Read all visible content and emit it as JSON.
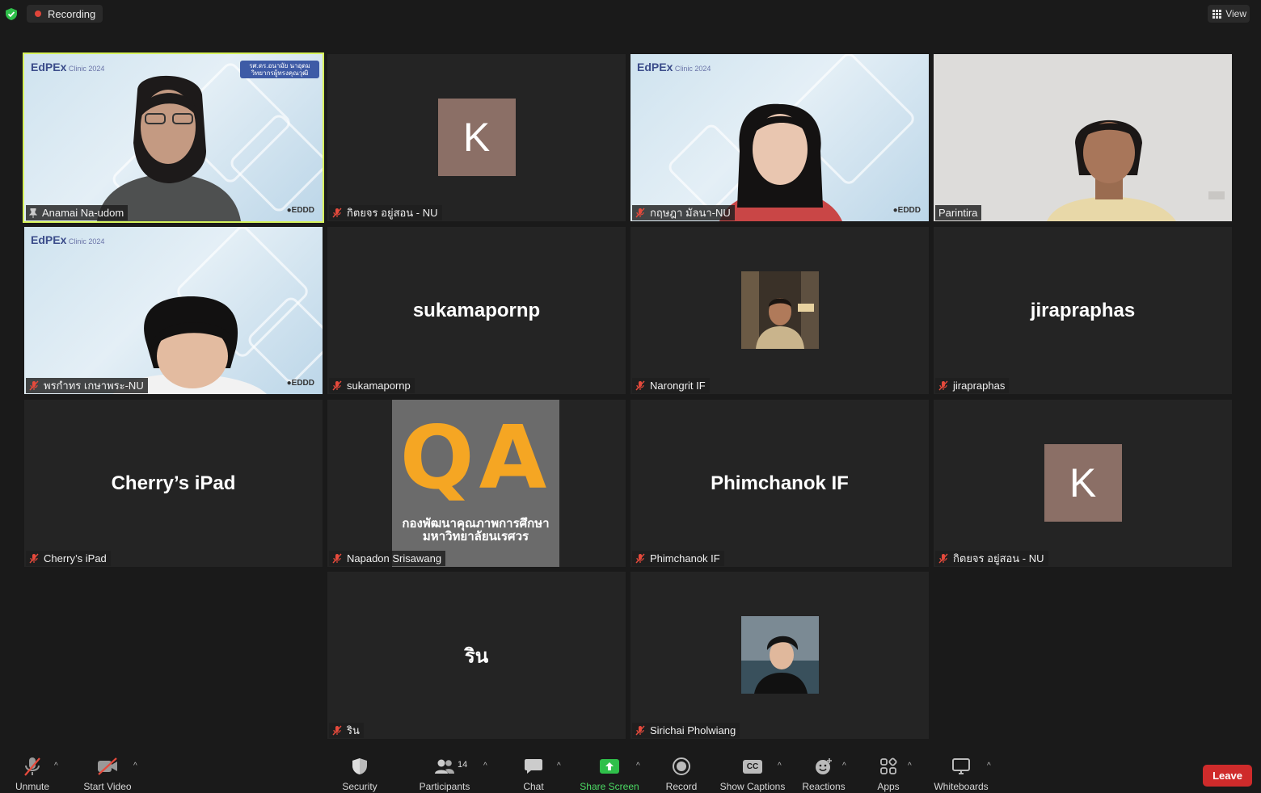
{
  "topbar": {
    "recording_label": "Recording",
    "view_label": "View"
  },
  "participants": [
    {
      "name": "Anamai Na-udom",
      "video": true,
      "pinned": true,
      "speaking": true,
      "background": "EdPEx Clinic 2024 Online",
      "ribbon_line1": "รศ.ดร.อนามัย นาอุดม",
      "ribbon_line2": "วิทยากรผู้ทรงคุณวุฒิ"
    },
    {
      "name": "กิตยจร อยู่สอน - NU",
      "video": false,
      "avatar_letter": "K",
      "muted": true
    },
    {
      "name": "กฤษฎา มัลนา-NU",
      "video": true,
      "muted": true,
      "background": "EdPEx Clinic 2024 Online"
    },
    {
      "name": "Parintira",
      "video": true,
      "muted": false
    },
    {
      "name": "พรกำทร เกษาพระ-NU",
      "video": true,
      "muted": true,
      "background": "EdPEx Clinic 2024 Online"
    },
    {
      "name": "sukamapornp",
      "video": false,
      "display_text": "sukamapornp",
      "muted": true
    },
    {
      "name": "Narongrit IF",
      "video": false,
      "profile_photo": true,
      "muted": true
    },
    {
      "name": "jirapraphas",
      "video": false,
      "display_text": "jirapraphas",
      "muted": true
    },
    {
      "name": "Cherry’s iPad",
      "video": false,
      "display_text": "Cherry’s iPad",
      "muted": true
    },
    {
      "name": "Napadon Srisawang",
      "video": false,
      "muted": true,
      "qa_letters": "QA",
      "qa_line1": "กองพัฒนาคุณภาพการศึกษา",
      "qa_line2": "มหาวิทยาลัยนเรศวร"
    },
    {
      "name": "Phimchanok IF",
      "video": false,
      "display_text": "Phimchanok IF",
      "muted": true
    },
    {
      "name": "กิตยจร อยู่สอน - NU",
      "video": false,
      "avatar_letter": "K",
      "muted": true
    },
    {
      "name": "ริน",
      "video": false,
      "display_text": "ริน",
      "muted": true
    },
    {
      "name": "Sirichai Pholwiang",
      "video": false,
      "profile_photo": true,
      "muted": true
    }
  ],
  "toolbar": {
    "unmute": "Unmute",
    "start_video": "Start Video",
    "security": "Security",
    "participants": "Participants",
    "participants_count": "14",
    "chat": "Chat",
    "share_screen": "Share Screen",
    "record": "Record",
    "show_captions": "Show Captions",
    "captions_badge": "CC",
    "reactions": "Reactions",
    "apps": "Apps",
    "whiteboards": "Whiteboards",
    "leave": "Leave"
  },
  "colors": {
    "speaking_border": "#d6f25c",
    "recording_dot": "#e0453a",
    "share_green": "#4cd964",
    "leave_red": "#cf2b2b",
    "avatar_bg": "#8b6f66",
    "qa_orange": "#f5a623"
  }
}
